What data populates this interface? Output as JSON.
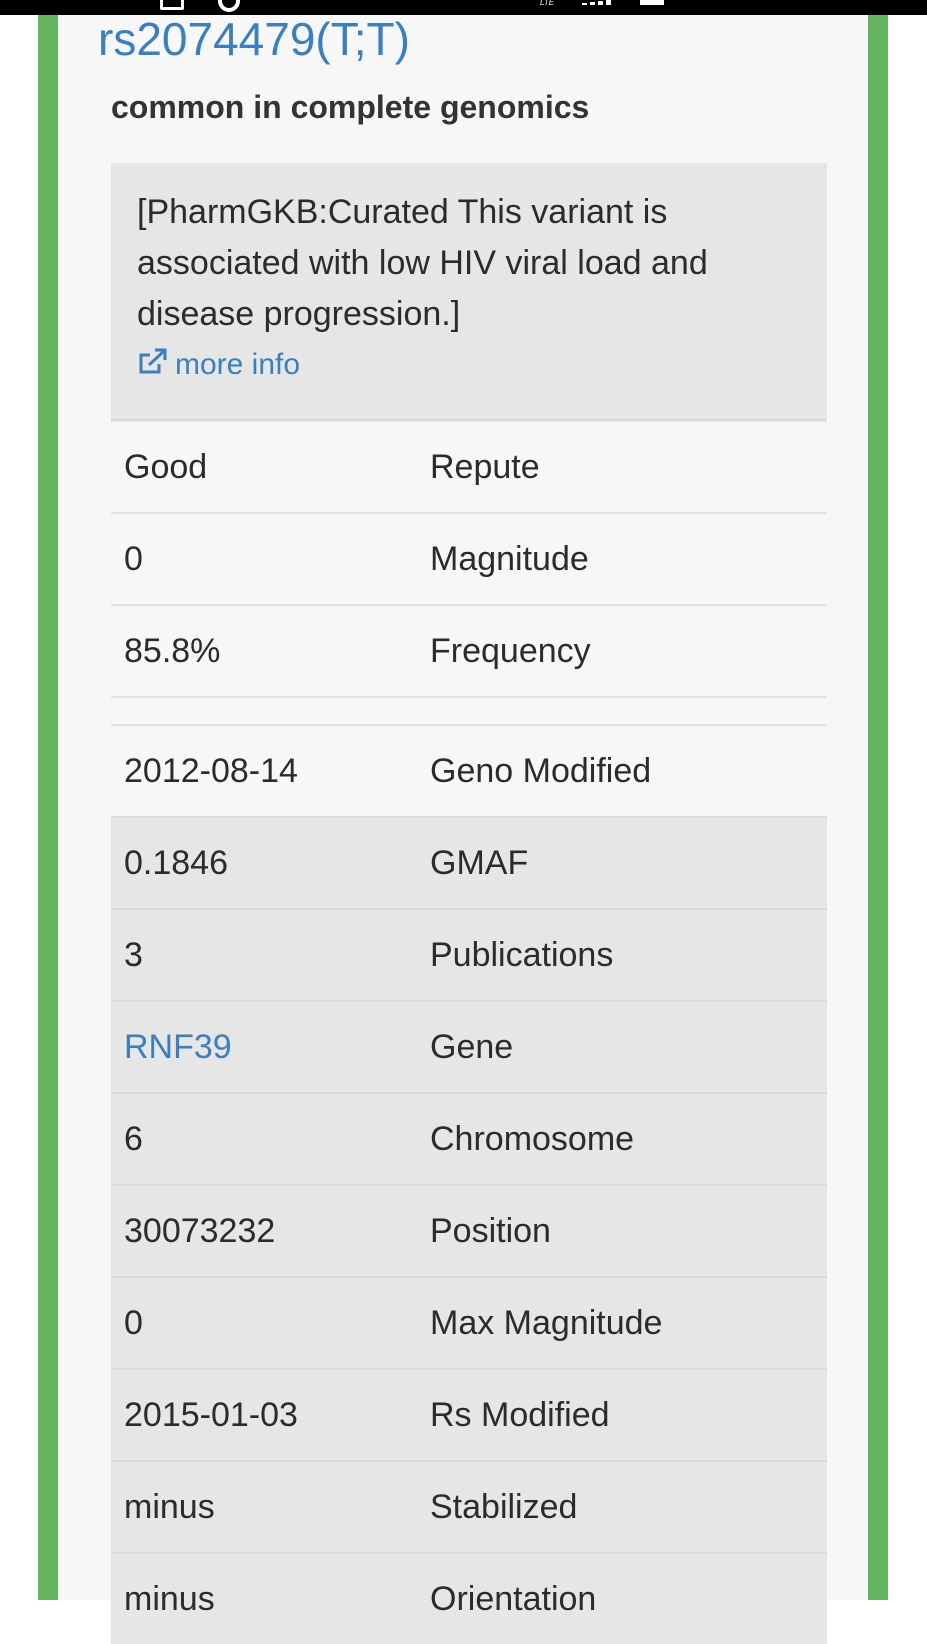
{
  "title": "rs2074479(T;T)",
  "subtitle": "common in complete genomics",
  "summary": {
    "text": "[PharmGKB:Curated This variant is associated with low HIV viral load and disease progression.]",
    "more_info_label": "more info",
    "more_info_icon": "external-link-icon"
  },
  "genotype_props": [
    {
      "value": "Good",
      "label": "Repute"
    },
    {
      "value": "0",
      "label": "Magnitude"
    },
    {
      "value": "85.8%",
      "label": "Frequency"
    }
  ],
  "geno_modified": {
    "value": "2012-08-14",
    "label": "Geno Modified"
  },
  "snp_props": [
    {
      "value": "0.1846",
      "label": "GMAF"
    },
    {
      "value": "3",
      "label": "Publications"
    },
    {
      "value": "RNF39",
      "label": "Gene"
    },
    {
      "value": "6",
      "label": "Chromosome"
    },
    {
      "value": "30073232",
      "label": "Position"
    },
    {
      "value": "0",
      "label": "Max Magnitude"
    },
    {
      "value": "2015-01-03",
      "label": "Rs Modified"
    },
    {
      "value": "minus",
      "label": "Stabilized"
    },
    {
      "value": "minus",
      "label": "Orientation"
    }
  ],
  "colors": {
    "accent_link": "#3a7fbf",
    "frame_green": "#65b561",
    "shaded_row": "#e6e6e6",
    "panel_bg": "#f7f7f7"
  }
}
